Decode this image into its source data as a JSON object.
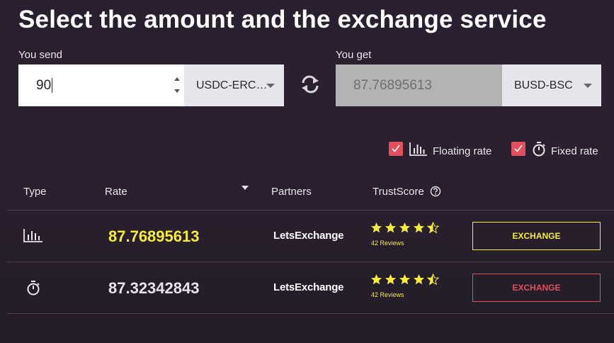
{
  "title": "Select the amount and the exchange service",
  "send": {
    "label": "You send",
    "amount": "90",
    "currency": "USDC-ERC…"
  },
  "get": {
    "label": "You get",
    "amount": "87.76895613",
    "currency": "BUSD-BSC"
  },
  "filters": {
    "floating": {
      "label": "Floating rate",
      "checked": true
    },
    "fixed": {
      "label": "Fixed rate",
      "checked": true
    }
  },
  "table": {
    "headers": {
      "type": "Type",
      "rate": "Rate",
      "partners": "Partners",
      "trust": "TrustScore"
    },
    "rows": [
      {
        "type_icon": "bar-chart-icon",
        "rate": "87.76895613",
        "partner": "LetsExchange",
        "stars": 4.5,
        "reviews": "42 Reviews",
        "action": "EXCHANGE"
      },
      {
        "type_icon": "stopwatch-icon",
        "rate": "87.32342843",
        "partner": "LetsExchange",
        "stars": 4.5,
        "reviews": "42 Reviews",
        "action": "EXCHANGE"
      }
    ]
  },
  "colors": {
    "accent_yellow": "#f5ec3d",
    "accent_red": "#e2505d",
    "background": "#2a1f30"
  }
}
